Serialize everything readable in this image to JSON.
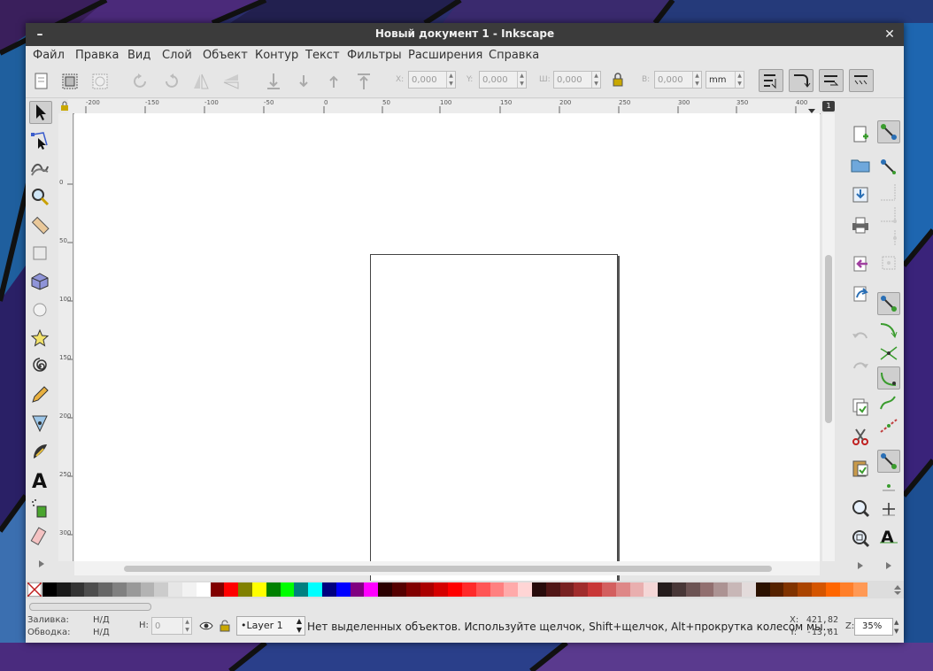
{
  "window": {
    "title": "Новый документ 1 - Inkscape",
    "minimize_glyph": "–",
    "close_glyph": "✕"
  },
  "menu": [
    {
      "label": "Файл"
    },
    {
      "label": "Правка"
    },
    {
      "label": "Вид"
    },
    {
      "label": "Слой"
    },
    {
      "label": "Объект"
    },
    {
      "label": "Контур"
    },
    {
      "label": "Текст"
    },
    {
      "label": "Фильтры"
    },
    {
      "label": "Расширения"
    },
    {
      "label": "Справка"
    }
  ],
  "toolbar": {
    "x_label": "X:",
    "x_value": "0,000",
    "y_label": "Y:",
    "y_value": "0,000",
    "w_label": "Ш:",
    "w_value": "0,000",
    "h_label": "В:",
    "h_value": "0,000",
    "unit": "mm"
  },
  "ruler": {
    "h_ticks": [
      "-200",
      "-150",
      "-100",
      "-50",
      "0",
      "50",
      "100",
      "150",
      "200",
      "250",
      "300",
      "350",
      "400"
    ],
    "v_ticks": [
      "0",
      "50",
      "100",
      "150",
      "200",
      "250",
      "300"
    ],
    "page_badge": "1"
  },
  "statusbar": {
    "fill_label": "Заливка:",
    "fill_value": "Н/Д",
    "stroke_label": "Обводка:",
    "stroke_value": "Н/Д",
    "h_label": "Н:",
    "h_value": "0",
    "layer": "•Layer 1",
    "message": "Нет выделенных объектов. Используйте щелчок, Shift+щелчок, Alt+прокрутка колесом мы...",
    "x_label": "X:",
    "x_value": "421,82",
    "y_label": "Y:",
    "y_value": "-13,61",
    "zoom_label": "Z:",
    "zoom_value": "35%"
  },
  "palette_colors": [
    "#000000",
    "#1a1a1a",
    "#333333",
    "#4d4d4d",
    "#666666",
    "#808080",
    "#999999",
    "#b3b3b3",
    "#cccccc",
    "#e6e6e6",
    "#f2f2f2",
    "#ffffff",
    "#800000",
    "#ff0000",
    "#808000",
    "#ffff00",
    "#008000",
    "#00ff00",
    "#008080",
    "#00ffff",
    "#000080",
    "#0000ff",
    "#800080",
    "#ff00ff",
    "#2b0000",
    "#550000",
    "#800000",
    "#aa0000",
    "#d40000",
    "#ff0000",
    "#ff2a2a",
    "#ff5555",
    "#ff8080",
    "#ffaaaa",
    "#ffd5d5",
    "#280b0b",
    "#501616",
    "#782121",
    "#a02c2c",
    "#c83737",
    "#d35f5f",
    "#de8787",
    "#e9afaf",
    "#f4d7d7",
    "#241c1c",
    "#483737",
    "#6c5353",
    "#916f6f",
    "#ac9393",
    "#c8b7b7",
    "#e3dbdb",
    "#2b1100",
    "#552200",
    "#803300",
    "#aa4400",
    "#d45500",
    "#ff6600",
    "#ff7f2a",
    "#ff9955"
  ]
}
